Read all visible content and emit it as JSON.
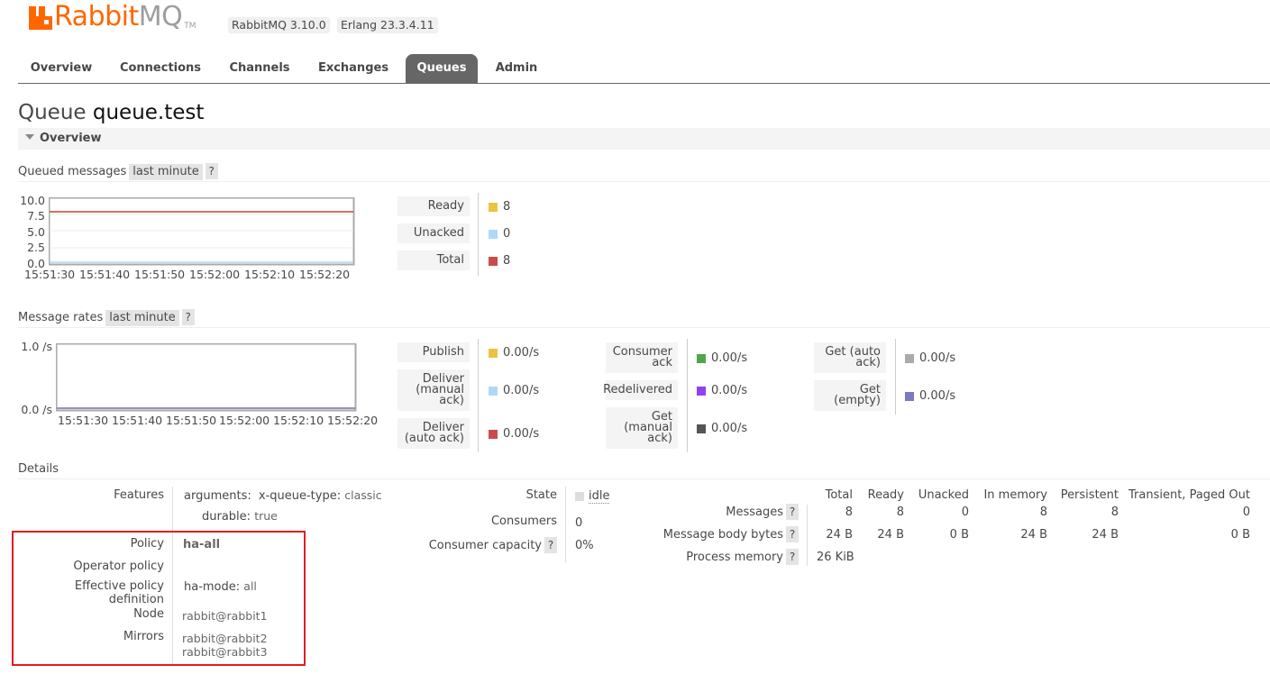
{
  "header": {
    "logo_left": "Rabbit",
    "logo_right": "MQ",
    "logo_tm": "TM",
    "version": "RabbitMQ 3.10.0",
    "erlang": "Erlang 23.3.4.11"
  },
  "tabs": [
    "Overview",
    "Connections",
    "Channels",
    "Exchanges",
    "Queues",
    "Admin"
  ],
  "active_tab": "Queues",
  "title": {
    "prefix": "Queue",
    "name": "queue.test"
  },
  "overview_section": "Overview",
  "queued": {
    "title": "Queued messages",
    "range": "last minute",
    "help": "?",
    "legend": [
      {
        "label": "Ready",
        "value": "8",
        "color": "#edc240"
      },
      {
        "label": "Unacked",
        "value": "0",
        "color": "#afd8f8"
      },
      {
        "label": "Total",
        "value": "8",
        "color": "#cb4b4b"
      }
    ]
  },
  "rates": {
    "title": "Message rates",
    "range": "last minute",
    "help": "?",
    "col1": [
      {
        "label": "Publish",
        "value": "0.00/s",
        "color": "#edc240"
      },
      {
        "label": "Deliver (manual ack)",
        "value": "0.00/s",
        "color": "#afd8f8"
      },
      {
        "label": "Deliver (auto ack)",
        "value": "0.00/s",
        "color": "#cb4b4b"
      }
    ],
    "col2": [
      {
        "label": "Consumer ack",
        "value": "0.00/s",
        "color": "#4da74d"
      },
      {
        "label": "Redelivered",
        "value": "0.00/s",
        "color": "#9440ed"
      },
      {
        "label": "Get (manual ack)",
        "value": "0.00/s",
        "color": "#555555"
      }
    ],
    "col3": [
      {
        "label": "Get (auto ack)",
        "value": "0.00/s",
        "color": "#aaaaaa"
      },
      {
        "label": "Get (empty)",
        "value": "0.00/s",
        "color": "#7c79c3"
      }
    ]
  },
  "chart_data": [
    {
      "type": "line",
      "title": "Queued messages",
      "x": [
        "15:51:30",
        "15:51:40",
        "15:51:50",
        "15:52:00",
        "15:52:10",
        "15:52:20"
      ],
      "yticks": [
        "10.0",
        "7.5",
        "5.0",
        "2.5",
        "0.0"
      ],
      "ylim": [
        0,
        10
      ],
      "series": [
        {
          "name": "Ready",
          "values": [
            8,
            8,
            8,
            8,
            8,
            8
          ],
          "color": "#edc240"
        },
        {
          "name": "Unacked",
          "values": [
            0,
            0,
            0,
            0,
            0,
            0
          ],
          "color": "#afd8f8"
        },
        {
          "name": "Total",
          "values": [
            8,
            8,
            8,
            8,
            8,
            8
          ],
          "color": "#cb4b4b"
        }
      ]
    },
    {
      "type": "line",
      "title": "Message rates",
      "x": [
        "15:51:30",
        "15:51:40",
        "15:51:50",
        "15:52:00",
        "15:52:10",
        "15:52:20"
      ],
      "yticks": [
        "1.0 /s",
        "0.0 /s"
      ],
      "ylim": [
        0,
        1
      ],
      "series": [
        {
          "name": "Publish",
          "values": [
            0,
            0,
            0,
            0,
            0,
            0
          ],
          "color": "#edc240"
        },
        {
          "name": "Get (empty)",
          "values": [
            0,
            0,
            0,
            0,
            0,
            0
          ],
          "color": "#7c79c3"
        }
      ]
    }
  ],
  "details": {
    "title": "Details",
    "features_label": "Features",
    "arguments_key": "arguments:",
    "queue_type_key": "x-queue-type:",
    "queue_type_val": "classic",
    "durable_key": "durable:",
    "durable_val": "true",
    "policy_label": "Policy",
    "policy_val": "ha-all",
    "operator_policy_label": "Operator policy",
    "effective_label": "Effective policy definition",
    "ha_mode_key": "ha-mode:",
    "ha_mode_val": "all",
    "node_label": "Node",
    "node_val": "rabbit@rabbit1",
    "mirrors_label": "Mirrors",
    "mirror1": "rabbit@rabbit2",
    "mirror2": "rabbit@rabbit3",
    "state_label": "State",
    "state_val": "idle",
    "consumers_label": "Consumers",
    "consumers_val": "0",
    "capacity_label": "Consumer capacity",
    "capacity_val": "0%",
    "help": "?",
    "stats_cols": [
      "Total",
      "Ready",
      "Unacked",
      "In memory",
      "Persistent",
      "Transient, Paged Out"
    ],
    "rows": [
      {
        "label": "Messages",
        "values": [
          "8",
          "8",
          "0",
          "8",
          "8",
          "0"
        ]
      },
      {
        "label": "Message body bytes",
        "values": [
          "24 B",
          "24 B",
          "0 B",
          "24 B",
          "24 B",
          "0 B"
        ]
      },
      {
        "label": "Process memory",
        "values": [
          "26 KiB"
        ]
      }
    ]
  }
}
